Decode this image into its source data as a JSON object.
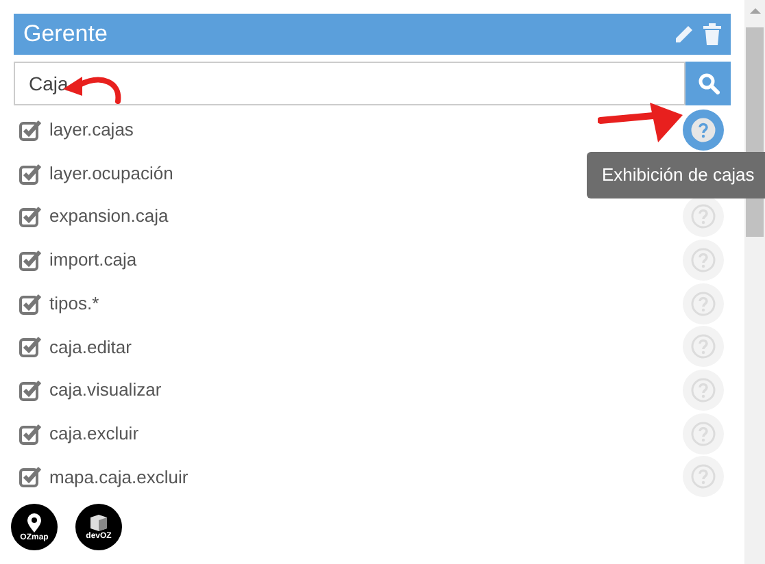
{
  "panel": {
    "title": "Gerente"
  },
  "search": {
    "value": "Caja"
  },
  "permissions": [
    {
      "label": "layer.cajas",
      "checked": true,
      "help_selected": true
    },
    {
      "label": "layer.ocupación",
      "checked": true
    },
    {
      "label": "expansion.caja",
      "checked": true,
      "help_selected": false
    },
    {
      "label": "import.caja",
      "checked": true,
      "help_selected": false
    },
    {
      "label": "tipos.*",
      "checked": true,
      "help_selected": false
    },
    {
      "label": "caja.editar",
      "checked": true,
      "help_selected": false
    },
    {
      "label": "caja.visualizar",
      "checked": true,
      "help_selected": false
    },
    {
      "label": "caja.excluir",
      "checked": true,
      "help_selected": false
    },
    {
      "label": "mapa.caja.excluir",
      "checked": true,
      "help_selected": false
    }
  ],
  "tooltip": "Exhibición de cajas",
  "logos": [
    {
      "kind": "pin",
      "text": "OZmap"
    },
    {
      "kind": "cube",
      "text": "devOZ"
    }
  ]
}
